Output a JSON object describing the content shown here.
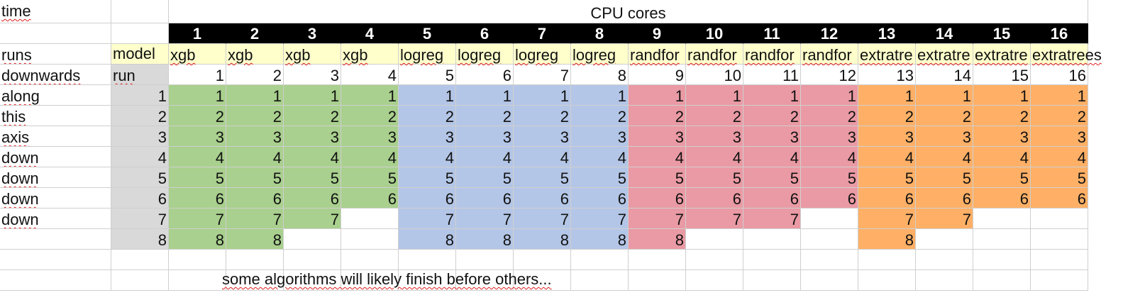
{
  "sheet": {
    "title": "CPU cores",
    "row_labels": [
      "time",
      "",
      "runs",
      "downwards",
      "along",
      "this",
      "axis",
      "down",
      "down",
      "down",
      "down"
    ],
    "header_row": [
      "1",
      "2",
      "3",
      "4",
      "5",
      "6",
      "7",
      "8",
      "9",
      "10",
      "11",
      "12",
      "13",
      "14",
      "15",
      "16"
    ],
    "model_label": "model",
    "models": [
      "xgb",
      "xgb",
      "xgb",
      "xgb",
      "logreg",
      "logreg",
      "logreg",
      "logreg",
      "randfor",
      "randfor",
      "randfor",
      "randfor",
      "extratre",
      "extratre",
      "extratre",
      "extratrees"
    ],
    "run_label": "run",
    "runs": [
      "1",
      "2",
      "3",
      "4",
      "5",
      "6",
      "7",
      "8",
      "9",
      "10",
      "11",
      "12",
      "13",
      "14",
      "15",
      "16"
    ],
    "run_index": [
      "1",
      "2",
      "3",
      "4",
      "5",
      "6",
      "7",
      "8"
    ],
    "column_counts": [
      8,
      8,
      7,
      6,
      8,
      8,
      8,
      8,
      8,
      7,
      7,
      6,
      8,
      7,
      6,
      6
    ],
    "colors": {
      "xgb": "#a9d08e",
      "logreg": "#b4c6e7",
      "randfor": "#ea9aa4",
      "extratrees": "#ffb066",
      "model_row": "#ffffcc",
      "index_col": "#d9d9d9",
      "header": "#000000"
    },
    "note": "some algorithms will likely finish before others..."
  }
}
